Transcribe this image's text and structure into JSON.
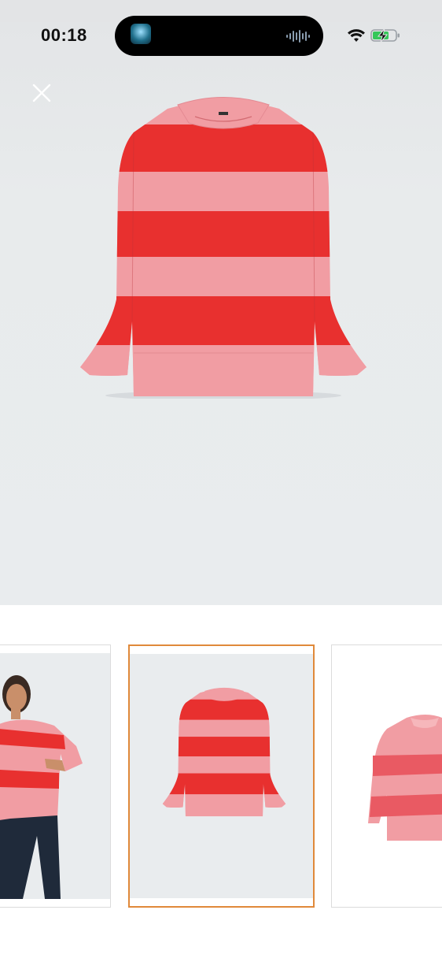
{
  "status_bar": {
    "time": "00:18",
    "activity_art_icon": "now-playing-artwork-icon",
    "audio_icon": "waveform-icon",
    "wifi_icon": "wifi-icon",
    "battery_icon": "battery-charging-icon",
    "battery_color": "#34c759"
  },
  "viewer": {
    "close_icon": "close-icon",
    "background_color": "#e9ecee",
    "main_image": "striped-sweater-product-photo"
  },
  "gallery": {
    "selected_index": 1,
    "selected_border_color": "#e0893a",
    "thumbnails": [
      {
        "image": "model-wearing-striped-sweater"
      },
      {
        "image": "striped-sweater-product-photo"
      },
      {
        "image": "striped-sweater-detail-photo"
      }
    ]
  },
  "colors": {
    "stripe_red": "#e8302f",
    "stripe_pink": "#f19da3"
  }
}
